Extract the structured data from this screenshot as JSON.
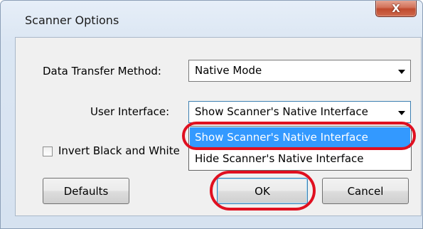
{
  "window": {
    "title": "Scanner Options",
    "close_symbol": "X"
  },
  "form": {
    "data_transfer_label": "Data Transfer Method:",
    "data_transfer_value": "Native Mode",
    "user_interface_label": "User Interface:",
    "user_interface_value": "Show Scanner's Native Interface",
    "invert_label": "Invert Black and White",
    "invert_checked": false
  },
  "dropdown": {
    "options": [
      "Show Scanner's Native Interface",
      "Hide Scanner's Native Interface"
    ],
    "selected_index": 0
  },
  "buttons": {
    "defaults": "Defaults",
    "ok": "OK",
    "cancel": "Cancel"
  },
  "colors": {
    "highlight_ring": "#e01020",
    "selection": "#3399ff"
  }
}
